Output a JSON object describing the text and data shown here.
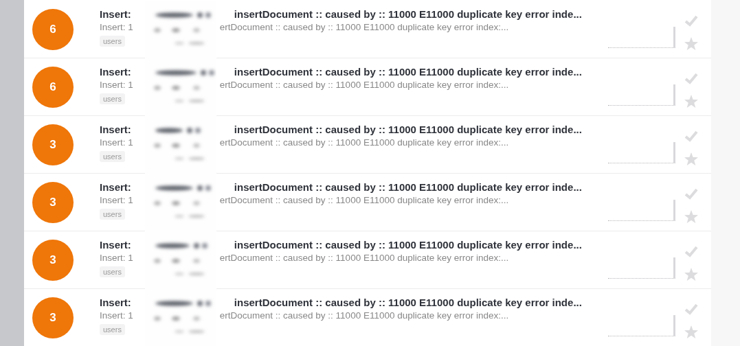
{
  "issues": [
    {
      "count": "6",
      "title_prefix": "Insert:",
      "title": "insertDocument :: caused by :: 11000 E11000 duplicate key error inde...",
      "summary_prefix": "Insert: 1",
      "summary": "ertDocument :: caused by :: 11000 E11000 duplicate key error index:...",
      "tag": "users",
      "resolved": false,
      "starred": false
    },
    {
      "count": "6",
      "title_prefix": "Insert:",
      "title": "insertDocument :: caused by :: 11000 E11000 duplicate key error inde...",
      "summary_prefix": "Insert: 1",
      "summary": "ertDocument :: caused by :: 11000 E11000 duplicate key error index:...",
      "tag": "users",
      "resolved": false,
      "starred": false
    },
    {
      "count": "3",
      "title_prefix": "Insert:",
      "title": "insertDocument :: caused by :: 11000 E11000 duplicate key error inde...",
      "summary_prefix": "Insert: 1",
      "summary": "ertDocument :: caused by :: 11000 E11000 duplicate key error index:...",
      "tag": "users",
      "resolved": false,
      "starred": false
    },
    {
      "count": "3",
      "title_prefix": "Insert:",
      "title": "insertDocument :: caused by :: 11000 E11000 duplicate key error inde...",
      "summary_prefix": "Insert: 1",
      "summary": "ertDocument :: caused by :: 11000 E11000 duplicate key error index:...",
      "tag": "users",
      "resolved": false,
      "starred": false
    },
    {
      "count": "3",
      "title_prefix": "Insert:",
      "title": "insertDocument :: caused by :: 11000 E11000 duplicate key error inde...",
      "summary_prefix": "Insert: 1",
      "summary": "ertDocument :: caused by :: 11000 E11000 duplicate key error index:...",
      "tag": "users",
      "resolved": false,
      "starred": false
    },
    {
      "count": "3",
      "title_prefix": "Insert:",
      "title": "insertDocument :: caused by :: 11000 E11000 duplicate key error inde...",
      "summary_prefix": "Insert: 1",
      "summary": "ertDocument :: caused by :: 11000 E11000 duplicate key error index:...",
      "tag": "users",
      "resolved": false,
      "starred": false
    }
  ]
}
